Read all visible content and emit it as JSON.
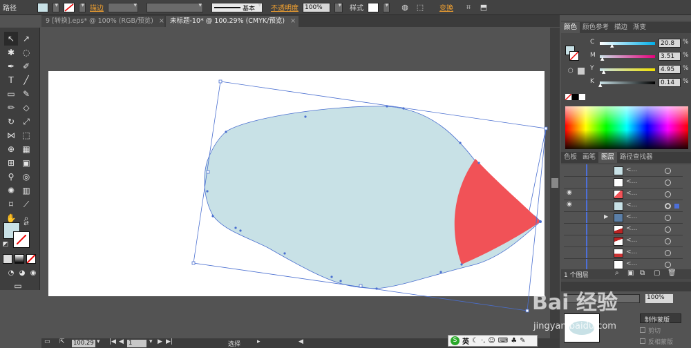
{
  "control_bar": {
    "object_type": "路径",
    "stroke_label": "描边",
    "stroke_style": "基本",
    "opacity_label": "不透明度",
    "opacity_value": "100%",
    "style_label": "样式",
    "transform_label": "变换",
    "fill_color": "#c8e1e6"
  },
  "doc_tabs": [
    {
      "label": "9 [转换].eps* @ 100% (RGB/预览)"
    },
    {
      "label": "未标题-10* @ 100.29% (CMYK/预览)"
    }
  ],
  "color_panel": {
    "tabs": [
      "颜色",
      "颜色参考",
      "描边",
      "渐变"
    ],
    "channels": [
      {
        "label": "C",
        "value": "20.8",
        "unit": "%",
        "color": "#00aee8"
      },
      {
        "label": "M",
        "value": "3.51",
        "unit": "%",
        "color": "#e8007c"
      },
      {
        "label": "Y",
        "value": "4.95",
        "unit": "%",
        "color": "#f0e000"
      },
      {
        "label": "K",
        "value": "0.14",
        "unit": "%",
        "color": "#000000"
      }
    ]
  },
  "layers_panel": {
    "tabs": [
      "色板",
      "画笔",
      "图层",
      "路径查找器"
    ],
    "row_name": "<...",
    "layer_count": "1 个图层"
  },
  "transparency_panel": {
    "opacity": "100%",
    "make_mask": "制作蒙版",
    "clip": "剪切",
    "invert_mask": "反相蒙版"
  },
  "status_bar": {
    "zoom": "100.29",
    "artboard_num": "1",
    "tool_name": "选择"
  },
  "ime": {
    "lang": "英"
  },
  "watermark": {
    "brand": "Bai  经验",
    "url": "jingyan.baidu.com"
  },
  "artwork": {
    "shape_fill": "#c8e1e6",
    "wedge_fill": "#f15257",
    "selection_color": "#4a6fd0"
  }
}
